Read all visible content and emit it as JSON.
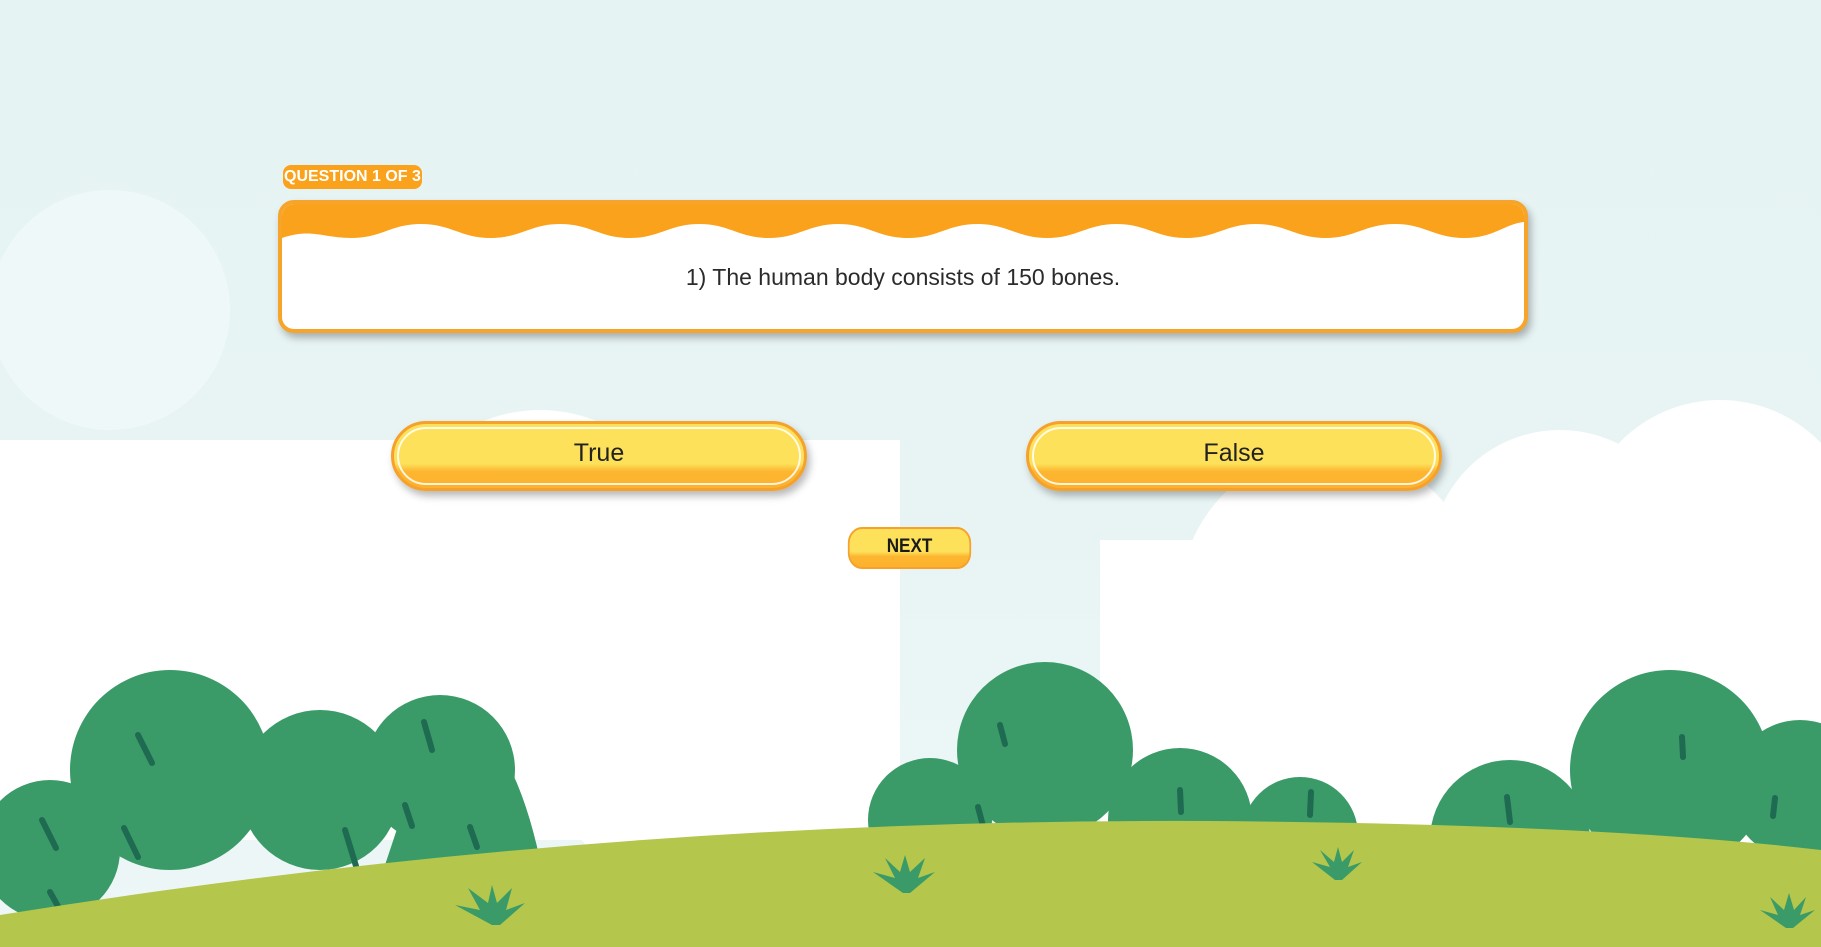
{
  "quiz": {
    "counter": "QUESTION 1 OF 3",
    "question": "1)  The human body consists of 150 bones.",
    "answers": [
      "True",
      "False"
    ],
    "next_label": "NEXT"
  },
  "colors": {
    "accent_orange": "#fba21c",
    "button_yellow": "#fde15a",
    "bush_green": "#3a9b68",
    "hill_green": "#b4c64c",
    "sky": "#e6f3f3"
  }
}
